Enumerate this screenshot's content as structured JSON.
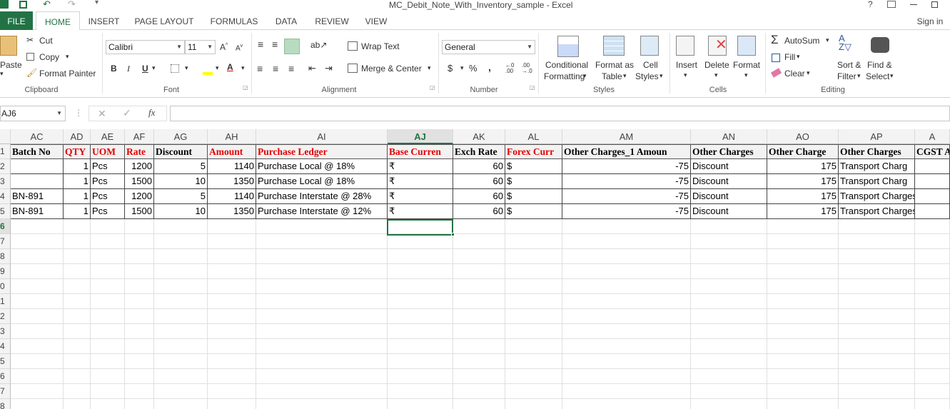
{
  "window": {
    "title": "MC_Debit_Note_With_Inventory_sample - Excel",
    "help": "?",
    "signin": "Sign in"
  },
  "tabs": [
    "FILE",
    "HOME",
    "INSERT",
    "PAGE LAYOUT",
    "FORMULAS",
    "DATA",
    "REVIEW",
    "VIEW"
  ],
  "ribbon": {
    "clipboard": {
      "paste": "Paste",
      "cut": "Cut",
      "copy": "Copy",
      "format_painter": "Format Painter",
      "label": "Clipboard"
    },
    "font": {
      "name": "Calibri",
      "size": "11",
      "bold": "B",
      "italic": "I",
      "underline": "U",
      "label": "Font"
    },
    "alignment": {
      "wrap": "Wrap Text",
      "merge": "Merge & Center",
      "label": "Alignment"
    },
    "number": {
      "format": "General",
      "currency": "$",
      "percent": "%",
      "comma": ",",
      "label": "Number"
    },
    "styles": {
      "conditional_1": "Conditional",
      "conditional_2": "Formatting",
      "format_table_1": "Format as",
      "format_table_2": "Table",
      "cell_styles_1": "Cell",
      "cell_styles_2": "Styles",
      "label": "Styles"
    },
    "cells": {
      "insert": "Insert",
      "delete": "Delete",
      "format": "Format",
      "label": "Cells"
    },
    "editing": {
      "autosum": "AutoSum",
      "fill": "Fill",
      "clear": "Clear",
      "sort_1": "Sort &",
      "sort_2": "Filter",
      "find_1": "Find &",
      "find_2": "Select",
      "label": "Editing"
    }
  },
  "formula_bar": {
    "name_box": "AJ6",
    "fx": "fx",
    "value": ""
  },
  "columns": [
    "AC",
    "AD",
    "AE",
    "AF",
    "AG",
    "AH",
    "AI",
    "AJ",
    "AK",
    "AL",
    "AM",
    "AN",
    "AO",
    "AP",
    "A"
  ],
  "selected_column": "AJ",
  "row_numbers": [
    "1",
    "2",
    "3",
    "4",
    "5",
    "6",
    "7",
    "8",
    "9",
    "0",
    "1",
    "2",
    "3",
    "4",
    "5",
    "6",
    "7",
    "8"
  ],
  "selected_row": "6",
  "headers": [
    "Batch No",
    "QTY",
    "UOM",
    "Rate",
    "Discount",
    "Amount",
    "Purchase Ledger",
    "Base Curren",
    "Exch Rate",
    "Forex Curr",
    "Other Charges_1 Amoun",
    "Other Charges",
    "Other Charge",
    "Other Charges",
    "CGST A"
  ],
  "rows": [
    [
      "",
      "1",
      "Pcs",
      "1200",
      "5",
      "1140",
      "Purchase Local @ 18%",
      "₹",
      "60",
      "$",
      "-75",
      "Discount",
      "175",
      "Transport Charg",
      ""
    ],
    [
      "",
      "1",
      "Pcs",
      "1500",
      "10",
      "1350",
      "Purchase Local @ 18%",
      "₹",
      "60",
      "$",
      "-75",
      "Discount",
      "175",
      "Transport Charg",
      ""
    ],
    [
      "BN-891",
      "1",
      "Pcs",
      "1200",
      "5",
      "1140",
      "Purchase Interstate @ 28%",
      "₹",
      "60",
      "$",
      "-75",
      "Discount",
      "175",
      "Transport Charges",
      ""
    ],
    [
      "BN-891",
      "1",
      "Pcs",
      "1500",
      "10",
      "1350",
      "Purchase Interstate @ 12%",
      "₹",
      "60",
      "$",
      "-75",
      "Discount",
      "175",
      "Transport Charges",
      ""
    ]
  ]
}
